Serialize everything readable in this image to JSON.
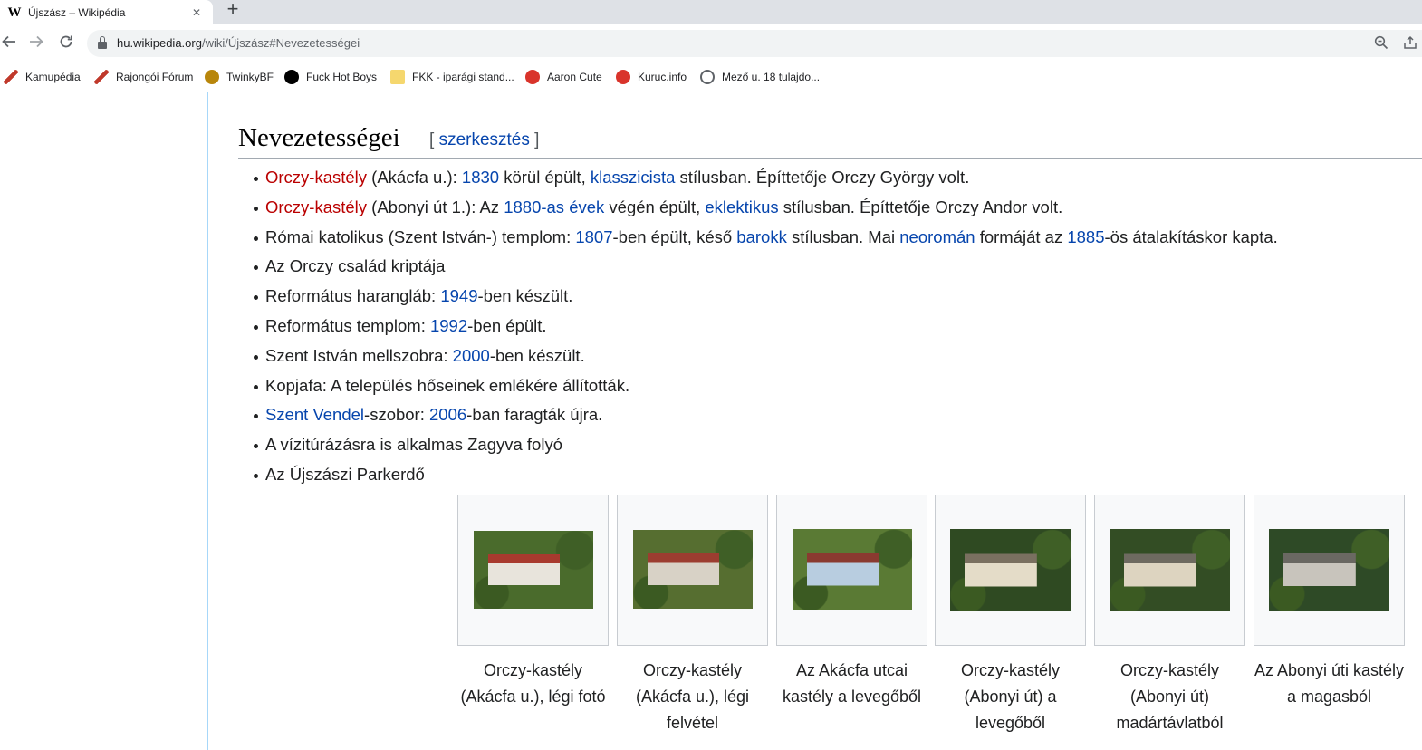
{
  "browser": {
    "tab_title": "Újszász – Wikipédia",
    "tab_favicon": "W",
    "close_glyph": "✕",
    "new_tab_glyph": "+",
    "url_host": "hu.wikipedia.org",
    "url_path": "/wiki/Újszász#Nevezetességei"
  },
  "bookmarks": [
    {
      "label": "Kamupédia",
      "icon": "kamupedia-icon",
      "color": "#c0392b"
    },
    {
      "label": "Rajongói Fórum",
      "icon": "forum-icon",
      "color": "#c0392b"
    },
    {
      "label": "TwinkyBF",
      "icon": "twinkybf-icon",
      "color": "#b8860b"
    },
    {
      "label": "Fuck Hot Boys",
      "icon": "fhb-icon",
      "color": "#000000"
    },
    {
      "label": "FKK - iparági stand...",
      "icon": "folder-icon",
      "color": "#f5d76e"
    },
    {
      "label": "Aaron Cute",
      "icon": "aaron-icon",
      "color": "#d9342b"
    },
    {
      "label": "Kuruc.info",
      "icon": "kuruc-icon",
      "color": "#d9342b"
    },
    {
      "label": "Mező u. 18 tulajdo...",
      "icon": "globe-icon",
      "color": "#5f6368"
    }
  ],
  "section": {
    "title": "Nevezetességei",
    "edit_open": "[ ",
    "edit_link": "szerkesztés",
    "edit_close": " ]"
  },
  "items": [
    [
      {
        "t": "Orczy-kastély",
        "k": "new"
      },
      {
        "t": " (Akácfa u.): ",
        "k": ""
      },
      {
        "t": "1830",
        "k": "link"
      },
      {
        "t": " körül épült, ",
        "k": ""
      },
      {
        "t": "klasszicista",
        "k": "link"
      },
      {
        "t": " stílusban. Építtetője Orczy György volt.",
        "k": ""
      }
    ],
    [
      {
        "t": "Orczy-kastély",
        "k": "new"
      },
      {
        "t": " (Abonyi út 1.): Az ",
        "k": ""
      },
      {
        "t": "1880-as évek",
        "k": "link"
      },
      {
        "t": " végén épült, ",
        "k": ""
      },
      {
        "t": "eklektikus",
        "k": "link"
      },
      {
        "t": " stílusban. Építtetője Orczy Andor volt.",
        "k": ""
      }
    ],
    [
      {
        "t": "Római katolikus (Szent István-) templom: ",
        "k": ""
      },
      {
        "t": "1807",
        "k": "link"
      },
      {
        "t": "-ben épült, késő ",
        "k": ""
      },
      {
        "t": "barokk",
        "k": "link"
      },
      {
        "t": " stílusban. Mai ",
        "k": ""
      },
      {
        "t": "neorománr",
        "k": "skip"
      }
    ],
    [
      {
        "t": "Az Orczy család kriptája",
        "k": ""
      }
    ],
    [
      {
        "t": "Református harangláb: ",
        "k": ""
      },
      {
        "t": "1949",
        "k": "link"
      },
      {
        "t": "-ben készült.",
        "k": ""
      }
    ],
    [
      {
        "t": "Református templom: ",
        "k": ""
      },
      {
        "t": "1992",
        "k": "link"
      },
      {
        "t": "-ben épült.",
        "k": ""
      }
    ],
    [
      {
        "t": "Szent István mellszobra: ",
        "k": ""
      },
      {
        "t": "2000",
        "k": "link"
      },
      {
        "t": "-ben készült.",
        "k": ""
      }
    ],
    [
      {
        "t": "Kopjafa: A település hőseinek emlékére állították.",
        "k": ""
      }
    ],
    [
      {
        "t": "Szent Vendel",
        "k": "link"
      },
      {
        "t": "-szobor: ",
        "k": ""
      },
      {
        "t": "2006",
        "k": "link"
      },
      {
        "t": "-ban faragták újra.",
        "k": ""
      }
    ],
    [
      {
        "t": "A vízitúrázásra is alkalmas Zagyva folyó",
        "k": ""
      }
    ],
    [
      {
        "t": "Az Újszászi Parkerdő",
        "k": ""
      }
    ]
  ],
  "gallery": [
    {
      "caption": "Orczy-kastély (Akácfa u.), légi fotó",
      "colors": [
        "#4a6b2c",
        "#e8e4dc",
        "#a83a2e"
      ]
    },
    {
      "caption": "Orczy-kastély (Akácfa u.), légi felvétel",
      "colors": [
        "#566e30",
        "#d8d2c6",
        "#9c3d30"
      ]
    },
    {
      "caption": "Az Akácfa utcai kastély a levegőből",
      "colors": [
        "#5a7a34",
        "#b8cde0",
        "#8a3a30"
      ]
    },
    {
      "caption": "Orczy-kastély (Abonyi út) a levegőből",
      "colors": [
        "#2f4a22",
        "#e4dcc8",
        "#7a7060"
      ]
    },
    {
      "caption": "Orczy-kastély (Abonyi út) madártávlatból",
      "colors": [
        "#334d24",
        "#ddd4c0",
        "#6e6a60"
      ]
    },
    {
      "caption": "Az Abonyi úti kastély a magasból",
      "colors": [
        "#2e4a26",
        "#c8c4bc",
        "#6a6862"
      ]
    }
  ]
}
